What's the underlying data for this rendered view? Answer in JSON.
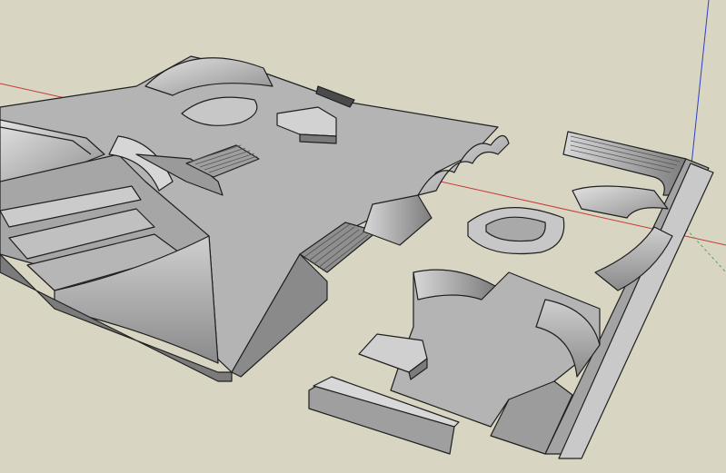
{
  "viewport": {
    "background": "#d9d5c3",
    "edge_color": "#1f1f1f",
    "face_colors": {
      "top": "#b4b4b4",
      "light": "#d6d6d6",
      "mid": "#9a9a9a",
      "dark": "#7b7b7b"
    },
    "axes": {
      "red_axis": "#c43a3a",
      "blue_axis": "#2f3fc7",
      "green_axis": "#5aa35a"
    }
  }
}
